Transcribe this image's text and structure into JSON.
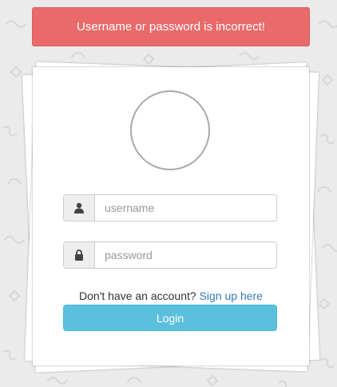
{
  "alert": {
    "message": "Username or password is incorrect!",
    "color": "#e96a6a"
  },
  "login_form": {
    "avatar_icon": "avatar-placeholder-circle",
    "username": {
      "icon": "user-icon",
      "placeholder": "username",
      "value": ""
    },
    "password": {
      "icon": "lock-icon",
      "placeholder": "password",
      "value": ""
    },
    "signup_prompt": "Don't have an account?",
    "signup_link": "Sign up here",
    "login_button": "Login",
    "button_color": "#5bc0de",
    "link_color": "#337ab7"
  }
}
